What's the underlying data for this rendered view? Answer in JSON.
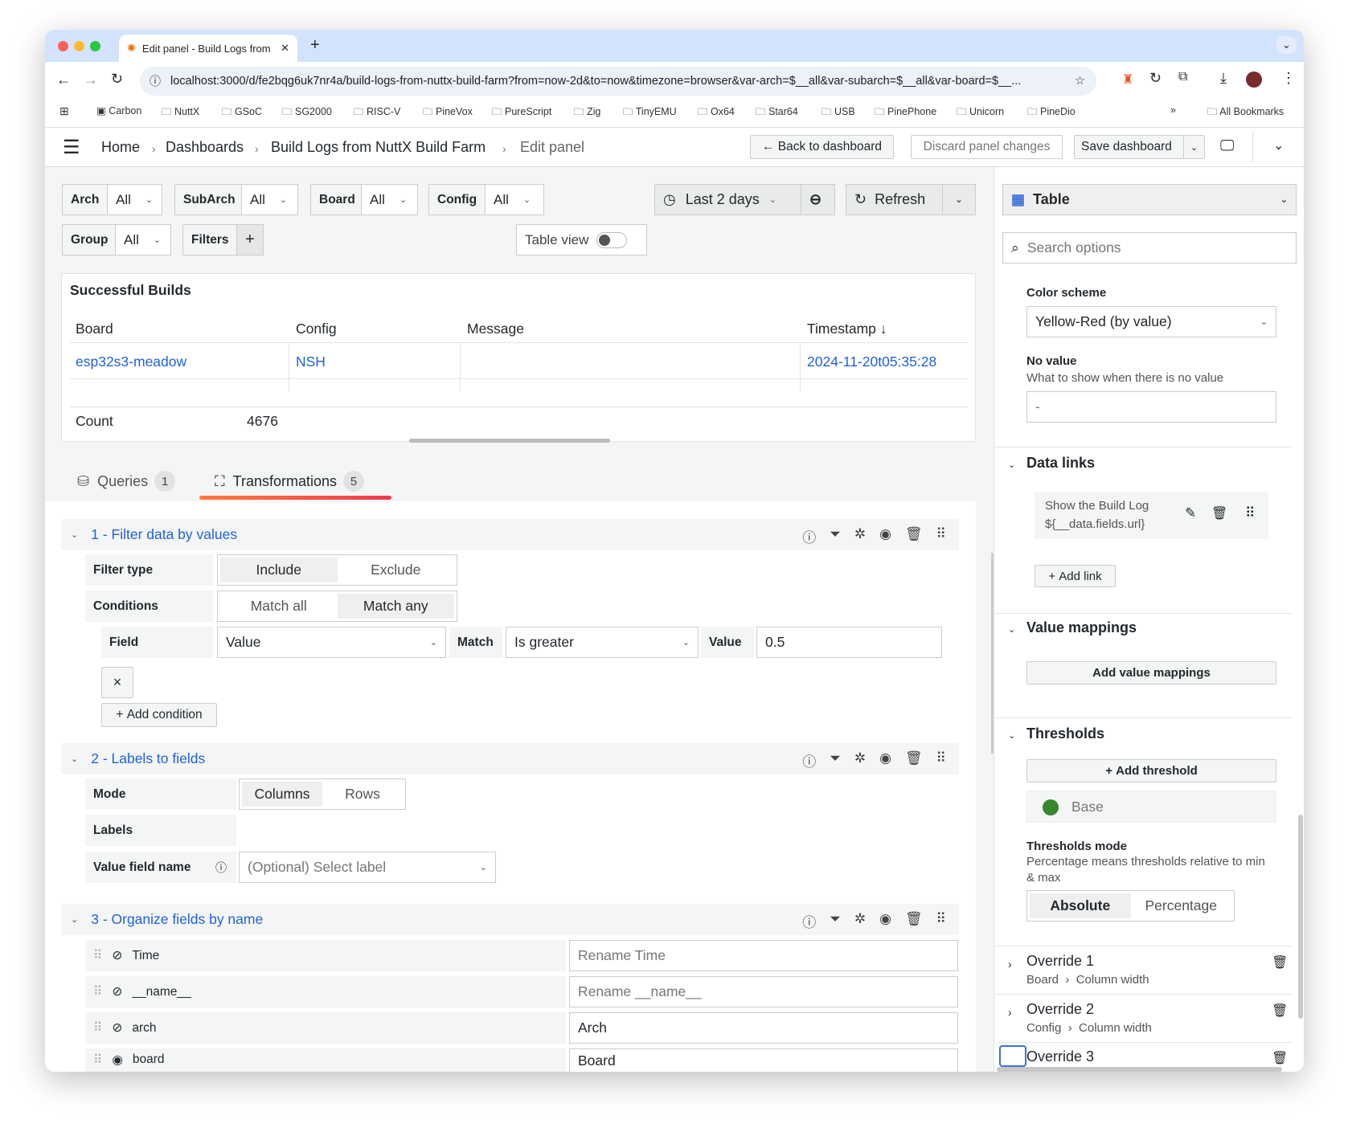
{
  "browser": {
    "tab_title": "Edit panel - Build Logs from N",
    "url": "localhost:3000/d/fe2bqg6uk7nr4a/build-logs-from-nuttx-build-farm?from=now-2d&to=now&timezone=browser&var-arch=$__all&var-subarch=$__all&var-board=$__...",
    "bookmarks": [
      "Carbon",
      "NuttX",
      "GSoC",
      "SG2000",
      "RISC-V",
      "PineVox",
      "PureScript",
      "Zig",
      "TinyEMU",
      "Ox64",
      "Star64",
      "USB",
      "PinePhone",
      "Unicorn",
      "PineDio"
    ],
    "all_bookmarks": "All Bookmarks"
  },
  "header": {
    "breadcrumb": [
      "Home",
      "Dashboards",
      "Build Logs from NuttX Build Farm",
      "Edit panel"
    ],
    "back": "Back to dashboard",
    "discard": "Discard panel changes",
    "save": "Save dashboard"
  },
  "variables": [
    {
      "label": "Arch",
      "value": "All"
    },
    {
      "label": "SubArch",
      "value": "All"
    },
    {
      "label": "Board",
      "value": "All"
    },
    {
      "label": "Config",
      "value": "All"
    },
    {
      "label": "Group",
      "value": "All"
    }
  ],
  "filters_label": "Filters",
  "table_view": "Table view",
  "time_range": "Last 2 days",
  "refresh": "Refresh",
  "panel": {
    "title": "Successful Builds",
    "columns": [
      "Board",
      "Config",
      "Message",
      "Timestamp"
    ],
    "row": [
      "esp32s3-meadow",
      "NSH",
      "",
      "2024-11-20t05:35:28"
    ],
    "footer_label": "Count",
    "footer_value": "4676"
  },
  "tabs": [
    {
      "label": "Queries",
      "count": "1"
    },
    {
      "label": "Transformations",
      "count": "5"
    }
  ],
  "transforms": {
    "t1": {
      "title": "1 - Filter data by values",
      "filter_type": "Filter type",
      "include": "Include",
      "exclude": "Exclude",
      "conditions": "Conditions",
      "match_all": "Match all",
      "match_any": "Match any",
      "field": "Field",
      "field_value": "Value",
      "match": "Match",
      "match_value": "Is greater",
      "value": "Value",
      "value_value": "0.5",
      "remove": "×",
      "add_condition": "Add condition"
    },
    "t2": {
      "title": "2 - Labels to fields",
      "mode": "Mode",
      "columns": "Columns",
      "rows": "Rows",
      "labels": "Labels",
      "value_field_name": "Value field name",
      "select_placeholder": "(Optional) Select label"
    },
    "t3": {
      "title": "3 - Organize fields by name",
      "fields": [
        {
          "name": "Time",
          "rename": "",
          "placeholder": "Rename Time",
          "hidden": true
        },
        {
          "name": "__name__",
          "rename": "",
          "placeholder": "Rename __name__",
          "hidden": true
        },
        {
          "name": "arch",
          "rename": "Arch",
          "placeholder": "",
          "hidden": true
        },
        {
          "name": "board",
          "rename": "Board",
          "placeholder": "",
          "hidden": false
        }
      ]
    }
  },
  "options": {
    "viz": "Table",
    "search_placeholder": "Search options",
    "color_scheme_label": "Color scheme",
    "color_scheme": "Yellow-Red (by value)",
    "no_value_label": "No value",
    "no_value_desc": "What to show when there is no value",
    "no_value": "-",
    "data_links": "Data links",
    "link_title": "Show the Build Log",
    "link_url": "${__data.fields.url}",
    "add_link": "Add link",
    "value_mappings": "Value mappings",
    "add_value_mappings": "Add value mappings",
    "thresholds": "Thresholds",
    "add_threshold": "Add threshold",
    "base": "Base",
    "base_color": "#37872d",
    "thresholds_mode": "Thresholds mode",
    "thresholds_mode_desc": "Percentage means thresholds relative to min & max",
    "absolute": "Absolute",
    "percentage": "Percentage",
    "overrides": [
      {
        "title": "Override 1",
        "field": "Board",
        "prop": "Column width"
      },
      {
        "title": "Override 2",
        "field": "Config",
        "prop": "Column width"
      },
      {
        "title": "Override 3"
      }
    ]
  }
}
